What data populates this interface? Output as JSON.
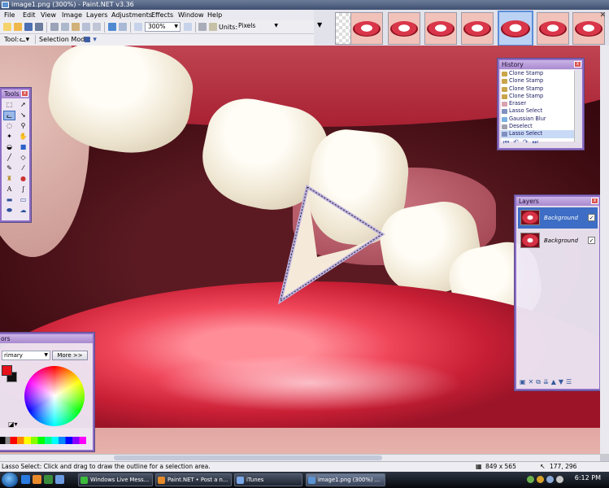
{
  "window": {
    "title": "image1.png (300%) - Paint.NET v3.36"
  },
  "menu": [
    "File",
    "Edit",
    "View",
    "Image",
    "Layers",
    "Adjustments",
    "Effects",
    "Window",
    "Help"
  ],
  "toolbar": {
    "zoom_value": "300%",
    "units_label": "Units:",
    "units_value": "Pixels",
    "tool_label": "Tool:",
    "selection_mode_label": "Selection Mode:"
  },
  "thumbnails": {
    "blank_label": "",
    "count": 7
  },
  "tools_panel": {
    "title": "Tools",
    "icons": [
      "rectangle-select-icon",
      "move-selection-icon",
      "lasso-select-icon",
      "move-selection-2-icon",
      "ellipse-select-icon",
      "zoom-icon",
      "magic-wand-icon",
      "pan-icon",
      "paint-bucket-icon",
      "gradient-icon",
      "paintbrush-icon",
      "eraser-icon",
      "pencil-icon",
      "color-picker-icon",
      "clone-stamp-icon",
      "recolor-icon",
      "text-icon",
      "line-curve-icon",
      "rectangle-icon",
      "rounded-rectangle-icon",
      "ellipse-icon",
      "freeform-shape-icon"
    ]
  },
  "history_panel": {
    "title": "History",
    "items": [
      {
        "label": "Clone Stamp",
        "state": "normal"
      },
      {
        "label": "Clone Stamp",
        "state": "normal"
      },
      {
        "label": "Clone Stamp",
        "state": "normal"
      },
      {
        "label": "Clone Stamp",
        "state": "normal"
      },
      {
        "label": "Eraser",
        "state": "normal"
      },
      {
        "label": "Lasso Select",
        "state": "normal"
      },
      {
        "label": "Gaussian Blur",
        "state": "normal"
      },
      {
        "label": "Deselect",
        "state": "normal"
      },
      {
        "label": "Lasso Select",
        "state": "current"
      }
    ]
  },
  "layers_panel": {
    "title": "Layers",
    "layers": [
      {
        "name": "Background",
        "visible": true,
        "selected": true
      },
      {
        "name": "Background",
        "visible": true,
        "selected": false
      }
    ]
  },
  "colors_panel": {
    "title": "ors",
    "palette_combo": "rimary",
    "more_button": "More >>",
    "primary_color": "#e6111b",
    "secondary_color": "#111111"
  },
  "statusbar": {
    "hint": "Lasso Select: Click and drag to draw the outline for a selection area.",
    "image_size": "849 x 565",
    "cursor_pos": "177, 296"
  },
  "taskbar": {
    "tasks": [
      {
        "label": "Windows Live Mess...",
        "active": false
      },
      {
        "label": "Paint.NET • Post a n...",
        "active": false
      },
      {
        "label": "iTunes",
        "active": false
      },
      {
        "label": "image1.png (300%) ...",
        "active": true
      }
    ],
    "clock": "6:12 PM"
  }
}
